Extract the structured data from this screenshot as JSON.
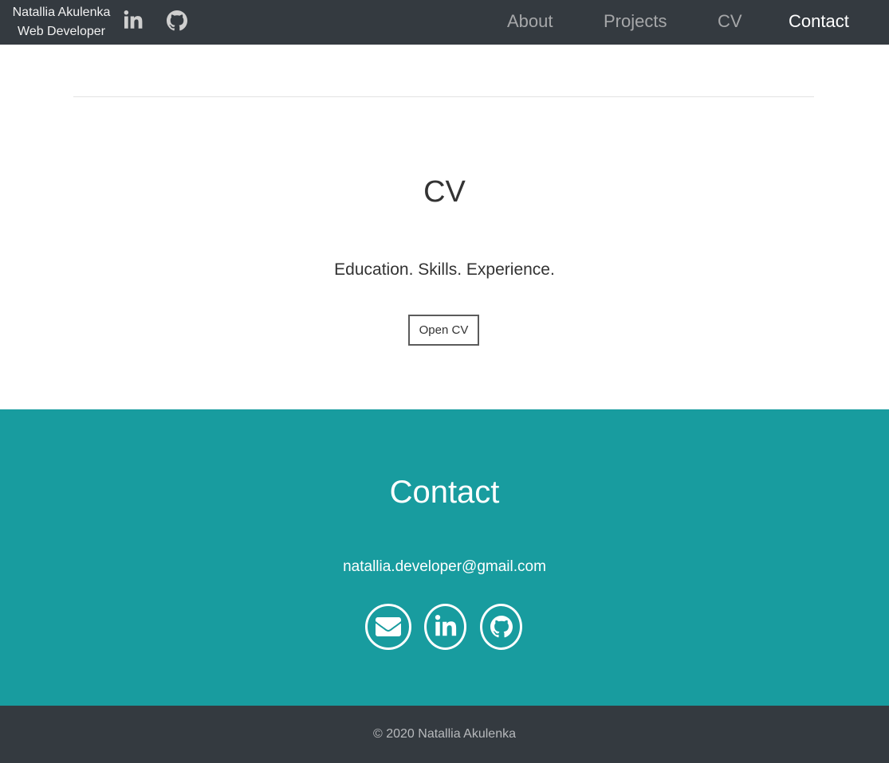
{
  "nav": {
    "brand_name": "Natallia Akulenka",
    "brand_role": "Web Developer",
    "social_icons": [
      "linkedin-icon",
      "github-icon"
    ],
    "links": [
      {
        "label": "About",
        "active": false
      },
      {
        "label": "Projects",
        "active": false
      },
      {
        "label": "CV",
        "active": false
      },
      {
        "label": "Contact",
        "active": true
      }
    ]
  },
  "cv": {
    "title": "CV",
    "subtitle": "Education. Skills. Experience.",
    "button_label": "Open CV"
  },
  "contact": {
    "title": "Contact",
    "email": "natallia.developer@gmail.com",
    "icons": [
      "envelope-icon",
      "linkedin-icon",
      "github-icon"
    ]
  },
  "footer": {
    "text": "© 2020 Natallia Akulenka"
  },
  "colors": {
    "navbar_bg": "#343a40",
    "contact_bg": "#189c9f",
    "nav_inactive": "#a6a7a9",
    "nav_active": "#ffffff"
  }
}
